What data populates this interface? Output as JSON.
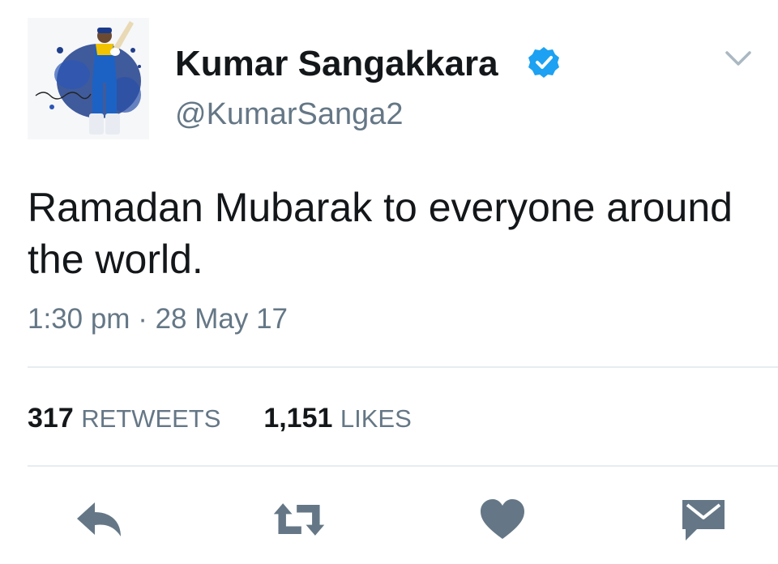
{
  "author": {
    "name": "Kumar Sangakkara",
    "handle": "@KumarSanga2",
    "avatar_signature": "Sangakkara"
  },
  "tweet": {
    "text": "Ramadan Mubarak to everyone around the world.",
    "timestamp": "1:30 pm · 28 May 17"
  },
  "stats": {
    "retweets_count": "317",
    "retweets_label": "RETWEETS",
    "likes_count": "1,151",
    "likes_label": "LIKES"
  },
  "icons": {
    "verified": "verified-badge-icon",
    "menu": "chevron-down-icon",
    "reply": "reply-icon",
    "retweet": "retweet-icon",
    "like": "heart-icon",
    "dm": "envelope-icon"
  },
  "colors": {
    "text_primary": "#14171a",
    "text_secondary": "#657786",
    "verified_blue": "#1da1f2",
    "action_icon": "#657786",
    "divider": "#e6ecf0"
  }
}
